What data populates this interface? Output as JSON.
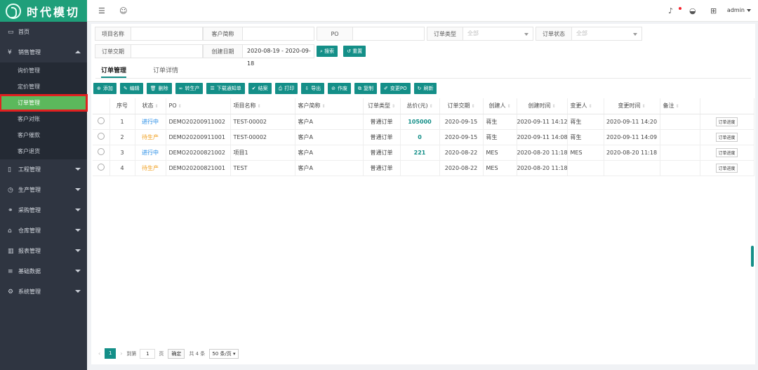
{
  "brand": {
    "logo_text": "时代模切"
  },
  "sidebar": {
    "items": [
      {
        "icon": "monitor-icon",
        "label": "首页",
        "expanded": false,
        "has_caret": false
      },
      {
        "icon": "yen-icon",
        "label": "销售管理",
        "expanded": true,
        "has_caret": true,
        "children": [
          "询价管理",
          "定价管理",
          "订单管理",
          "客户对账",
          "客户催款",
          "客户退货"
        ],
        "active_child": 2
      },
      {
        "icon": "document-icon",
        "label": "工程管理",
        "has_caret": true
      },
      {
        "icon": "clock-icon",
        "label": "生产管理",
        "has_caret": true
      },
      {
        "icon": "handshake-icon",
        "label": "采购管理",
        "has_caret": true
      },
      {
        "icon": "home-icon",
        "label": "仓库管理",
        "has_caret": true
      },
      {
        "icon": "bar-chart-icon",
        "label": "报表管理",
        "has_caret": true
      },
      {
        "icon": "database-icon",
        "label": "基础数据",
        "has_caret": true
      },
      {
        "icon": "gear-icon",
        "label": "系统管理",
        "has_caret": true
      }
    ]
  },
  "topbar": {
    "user": "admin"
  },
  "filters": {
    "project_name": {
      "label": "项目名称",
      "value": ""
    },
    "customer_short": {
      "label": "客户简称",
      "value": ""
    },
    "po": {
      "label": "PO",
      "value": ""
    },
    "order_type": {
      "label": "订单类型",
      "value": "全部"
    },
    "order_status": {
      "label": "订单状态",
      "value": "全部"
    },
    "delivery": {
      "label": "订单交期",
      "value": ""
    },
    "created_date": {
      "label": "创建日期",
      "value": "2020-08-19 - 2020-09-18"
    },
    "search_label": "搜索",
    "reset_label": "重置"
  },
  "tabs": [
    "订单管理",
    "订单详情"
  ],
  "toolbar": [
    {
      "icon": "plus-circle-icon",
      "label": "添加"
    },
    {
      "icon": "edit-icon",
      "label": "编辑"
    },
    {
      "icon": "trash-icon",
      "label": "删除"
    },
    {
      "icon": "link-icon",
      "label": "转生产"
    },
    {
      "icon": "list-icon",
      "label": "下载通知单"
    },
    {
      "icon": "check-circle-icon",
      "label": "结案"
    },
    {
      "icon": "print-icon",
      "label": "打印"
    },
    {
      "icon": "export-icon",
      "label": "导出"
    },
    {
      "icon": "void-icon",
      "label": "作废"
    },
    {
      "icon": "copy-icon",
      "label": "复制"
    },
    {
      "icon": "pencil-icon",
      "label": "变更PO"
    },
    {
      "icon": "refresh-icon",
      "label": "刷新"
    }
  ],
  "table": {
    "columns": [
      "序号",
      "状态",
      "PO",
      "项目名称",
      "客户简称",
      "订单类型",
      "总价(元)",
      "订单交期",
      "创建人",
      "创建时间",
      "变更人",
      "变更时间",
      "备注"
    ],
    "progress_label": "订单进度",
    "rows": [
      {
        "no": "1",
        "status": "进行中",
        "status_type": "running",
        "po": "DEMO20200911002",
        "project": "TEST-00002",
        "customer": "客户A",
        "type": "普通订单",
        "total": "105000",
        "delivery": "2020-09-15",
        "creator": "蒋生",
        "created": "2020-09-11 14:12",
        "changer": "蒋生",
        "changed": "2020-09-11 14:20",
        "remark": ""
      },
      {
        "no": "2",
        "status": "待生产",
        "status_type": "pending",
        "po": "DEMO20200911001",
        "project": "TEST-00002",
        "customer": "客户A",
        "type": "普通订单",
        "total": "0",
        "delivery": "2020-09-15",
        "creator": "蒋生",
        "created": "2020-09-11 14:08",
        "changer": "蒋生",
        "changed": "2020-09-11 14:09",
        "remark": ""
      },
      {
        "no": "3",
        "status": "进行中",
        "status_type": "running",
        "po": "DEMO20200821002",
        "project": "项目1",
        "customer": "客户A",
        "type": "普通订单",
        "total": "221",
        "delivery": "2020-08-22",
        "creator": "MES",
        "created": "2020-08-20 11:18",
        "changer": "MES",
        "changed": "2020-08-20 11:18",
        "remark": ""
      },
      {
        "no": "4",
        "status": "待生产",
        "status_type": "pending",
        "po": "DEMO20200821001",
        "project": "TEST",
        "customer": "客户A",
        "type": "普通订单",
        "total": "",
        "delivery": "2020-08-22",
        "creator": "MES",
        "created": "2020-08-20 11:18",
        "changer": "",
        "changed": "",
        "remark": ""
      }
    ]
  },
  "pager": {
    "current": "1",
    "goto_prefix": "到第",
    "goto_value": "1",
    "goto_suffix": "页",
    "confirm": "确定",
    "total": "共 4 条",
    "page_size": "50 条/页"
  },
  "colors": {
    "accent": "#148f88",
    "sidebar": "#2f3541",
    "active_menu": "#5cb85c",
    "running": "#1e88e5",
    "pending": "#f0a020"
  }
}
